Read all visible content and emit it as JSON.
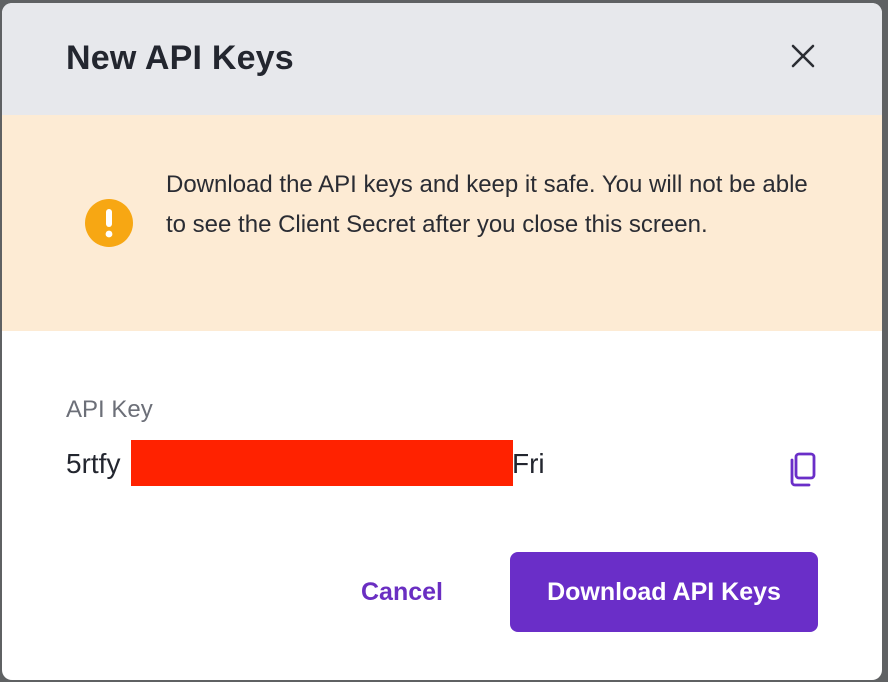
{
  "dialog": {
    "title": "New API Keys",
    "close_icon": "close-icon"
  },
  "warning": {
    "icon": "exclamation-circle-icon",
    "icon_color": "#f7a713",
    "text": "Download the API keys and keep it safe. You will not be able to see the Client Secret after you close this screen."
  },
  "api_key": {
    "label": "API Key",
    "value_prefix": "5rtfy",
    "value_suffix": "Fri",
    "copy_icon": "copy-icon"
  },
  "actions": {
    "cancel_label": "Cancel",
    "download_label": "Download API Keys"
  },
  "colors": {
    "accent": "#6a2ec8",
    "warning_bg": "#fdebd4",
    "header_bg": "#e7e8ec",
    "redaction": "#ff2200"
  }
}
